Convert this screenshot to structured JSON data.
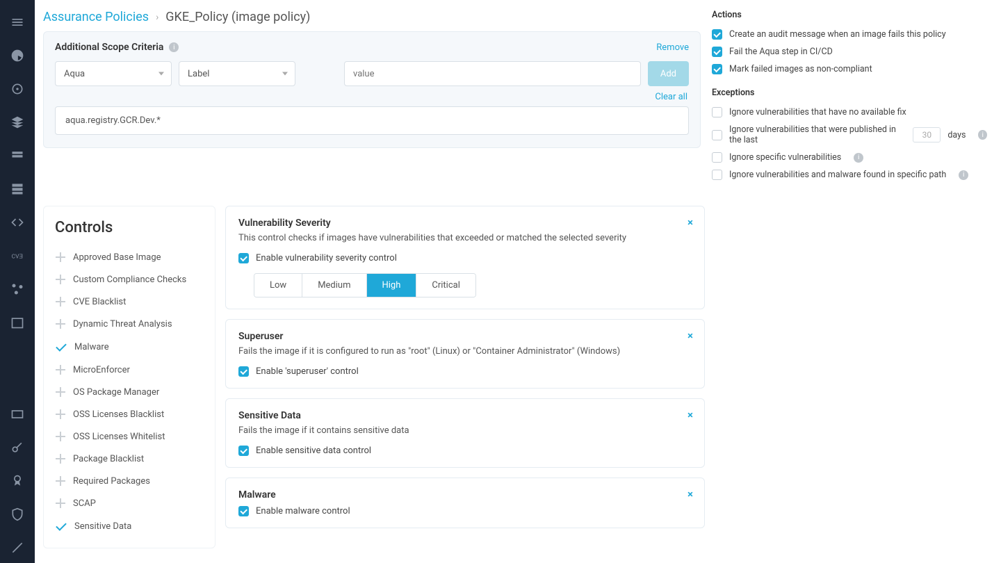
{
  "breadcrumb": {
    "root": "Assurance Policies",
    "current": "GKE_Policy (image policy)"
  },
  "scope": {
    "title": "Additional Scope Criteria",
    "remove": "Remove",
    "sel1": "Aqua",
    "sel2": "Label",
    "value_ph": "value",
    "add": "Add",
    "clear": "Clear all",
    "entry": "aqua.registry.GCR.Dev.*"
  },
  "actions": {
    "title": "Actions",
    "a1": "Create an audit message when an image fails this policy",
    "a2": "Fail the Aqua step in CI/CD",
    "a3": "Mark failed images as non-compliant"
  },
  "exceptions": {
    "title": "Exceptions",
    "e1": "Ignore vulnerabilities that have no available fix",
    "e2a": "Ignore vulnerabilities that were published in the last",
    "e2_num": "30",
    "e2b": "days",
    "e3": "Ignore specific vulnerabilities",
    "e4": "Ignore vulnerabilities and malware found in specific path"
  },
  "controls": {
    "title": "Controls",
    "items": [
      {
        "label": "Approved Base Image",
        "on": false
      },
      {
        "label": "Custom Compliance Checks",
        "on": false
      },
      {
        "label": "CVE Blacklist",
        "on": false
      },
      {
        "label": "Dynamic Threat Analysis",
        "on": false
      },
      {
        "label": "Malware",
        "on": true
      },
      {
        "label": "MicroEnforcer",
        "on": false
      },
      {
        "label": "OS Package Manager",
        "on": false
      },
      {
        "label": "OSS Licenses Blacklist",
        "on": false
      },
      {
        "label": "OSS Licenses Whitelist",
        "on": false
      },
      {
        "label": "Package Blacklist",
        "on": false
      },
      {
        "label": "Required Packages",
        "on": false
      },
      {
        "label": "SCAP",
        "on": false
      },
      {
        "label": "Sensitive Data",
        "on": true
      }
    ]
  },
  "cards": {
    "vuln": {
      "title": "Vulnerability Severity",
      "desc": "This control checks if images have vulnerabilities that exceeded or matched the selected severity",
      "enable": "Enable vulnerability severity control",
      "sev": [
        "Low",
        "Medium",
        "High",
        "Critical"
      ],
      "active": "High"
    },
    "su": {
      "title": "Superuser",
      "desc": "Fails the image if it is configured to run as \"root\" (Linux) or \"Container Administrator\" (Windows)",
      "enable": "Enable 'superuser' control"
    },
    "sd": {
      "title": "Sensitive Data",
      "desc": "Fails the image if it contains sensitive data",
      "enable": "Enable sensitive data control"
    },
    "mw": {
      "title": "Malware",
      "enable": "Enable malware control"
    }
  }
}
